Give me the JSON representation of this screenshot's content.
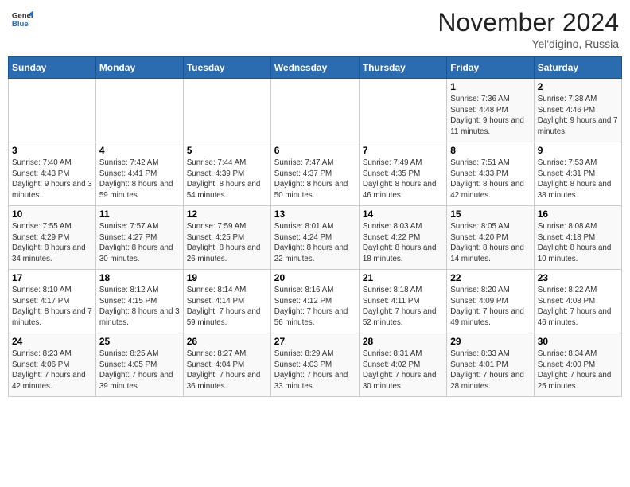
{
  "header": {
    "logo": {
      "general": "General",
      "blue": "Blue"
    },
    "month_title": "November 2024",
    "subtitle": "Yel'digino, Russia"
  },
  "calendar": {
    "days_of_week": [
      "Sunday",
      "Monday",
      "Tuesday",
      "Wednesday",
      "Thursday",
      "Friday",
      "Saturday"
    ],
    "weeks": [
      [
        {
          "day": "",
          "info": ""
        },
        {
          "day": "",
          "info": ""
        },
        {
          "day": "",
          "info": ""
        },
        {
          "day": "",
          "info": ""
        },
        {
          "day": "",
          "info": ""
        },
        {
          "day": "1",
          "info": "Sunrise: 7:36 AM\nSunset: 4:48 PM\nDaylight: 9 hours\nand 11 minutes."
        },
        {
          "day": "2",
          "info": "Sunrise: 7:38 AM\nSunset: 4:46 PM\nDaylight: 9 hours\nand 7 minutes."
        }
      ],
      [
        {
          "day": "3",
          "info": "Sunrise: 7:40 AM\nSunset: 4:43 PM\nDaylight: 9 hours\nand 3 minutes."
        },
        {
          "day": "4",
          "info": "Sunrise: 7:42 AM\nSunset: 4:41 PM\nDaylight: 8 hours\nand 59 minutes."
        },
        {
          "day": "5",
          "info": "Sunrise: 7:44 AM\nSunset: 4:39 PM\nDaylight: 8 hours\nand 54 minutes."
        },
        {
          "day": "6",
          "info": "Sunrise: 7:47 AM\nSunset: 4:37 PM\nDaylight: 8 hours\nand 50 minutes."
        },
        {
          "day": "7",
          "info": "Sunrise: 7:49 AM\nSunset: 4:35 PM\nDaylight: 8 hours\nand 46 minutes."
        },
        {
          "day": "8",
          "info": "Sunrise: 7:51 AM\nSunset: 4:33 PM\nDaylight: 8 hours\nand 42 minutes."
        },
        {
          "day": "9",
          "info": "Sunrise: 7:53 AM\nSunset: 4:31 PM\nDaylight: 8 hours\nand 38 minutes."
        }
      ],
      [
        {
          "day": "10",
          "info": "Sunrise: 7:55 AM\nSunset: 4:29 PM\nDaylight: 8 hours\nand 34 minutes."
        },
        {
          "day": "11",
          "info": "Sunrise: 7:57 AM\nSunset: 4:27 PM\nDaylight: 8 hours\nand 30 minutes."
        },
        {
          "day": "12",
          "info": "Sunrise: 7:59 AM\nSunset: 4:25 PM\nDaylight: 8 hours\nand 26 minutes."
        },
        {
          "day": "13",
          "info": "Sunrise: 8:01 AM\nSunset: 4:24 PM\nDaylight: 8 hours\nand 22 minutes."
        },
        {
          "day": "14",
          "info": "Sunrise: 8:03 AM\nSunset: 4:22 PM\nDaylight: 8 hours\nand 18 minutes."
        },
        {
          "day": "15",
          "info": "Sunrise: 8:05 AM\nSunset: 4:20 PM\nDaylight: 8 hours\nand 14 minutes."
        },
        {
          "day": "16",
          "info": "Sunrise: 8:08 AM\nSunset: 4:18 PM\nDaylight: 8 hours\nand 10 minutes."
        }
      ],
      [
        {
          "day": "17",
          "info": "Sunrise: 8:10 AM\nSunset: 4:17 PM\nDaylight: 8 hours\nand 7 minutes."
        },
        {
          "day": "18",
          "info": "Sunrise: 8:12 AM\nSunset: 4:15 PM\nDaylight: 8 hours\nand 3 minutes."
        },
        {
          "day": "19",
          "info": "Sunrise: 8:14 AM\nSunset: 4:14 PM\nDaylight: 7 hours\nand 59 minutes."
        },
        {
          "day": "20",
          "info": "Sunrise: 8:16 AM\nSunset: 4:12 PM\nDaylight: 7 hours\nand 56 minutes."
        },
        {
          "day": "21",
          "info": "Sunrise: 8:18 AM\nSunset: 4:11 PM\nDaylight: 7 hours\nand 52 minutes."
        },
        {
          "day": "22",
          "info": "Sunrise: 8:20 AM\nSunset: 4:09 PM\nDaylight: 7 hours\nand 49 minutes."
        },
        {
          "day": "23",
          "info": "Sunrise: 8:22 AM\nSunset: 4:08 PM\nDaylight: 7 hours\nand 46 minutes."
        }
      ],
      [
        {
          "day": "24",
          "info": "Sunrise: 8:23 AM\nSunset: 4:06 PM\nDaylight: 7 hours\nand 42 minutes."
        },
        {
          "day": "25",
          "info": "Sunrise: 8:25 AM\nSunset: 4:05 PM\nDaylight: 7 hours\nand 39 minutes."
        },
        {
          "day": "26",
          "info": "Sunrise: 8:27 AM\nSunset: 4:04 PM\nDaylight: 7 hours\nand 36 minutes."
        },
        {
          "day": "27",
          "info": "Sunrise: 8:29 AM\nSunset: 4:03 PM\nDaylight: 7 hours\nand 33 minutes."
        },
        {
          "day": "28",
          "info": "Sunrise: 8:31 AM\nSunset: 4:02 PM\nDaylight: 7 hours\nand 30 minutes."
        },
        {
          "day": "29",
          "info": "Sunrise: 8:33 AM\nSunset: 4:01 PM\nDaylight: 7 hours\nand 28 minutes."
        },
        {
          "day": "30",
          "info": "Sunrise: 8:34 AM\nSunset: 4:00 PM\nDaylight: 7 hours\nand 25 minutes."
        }
      ]
    ]
  }
}
